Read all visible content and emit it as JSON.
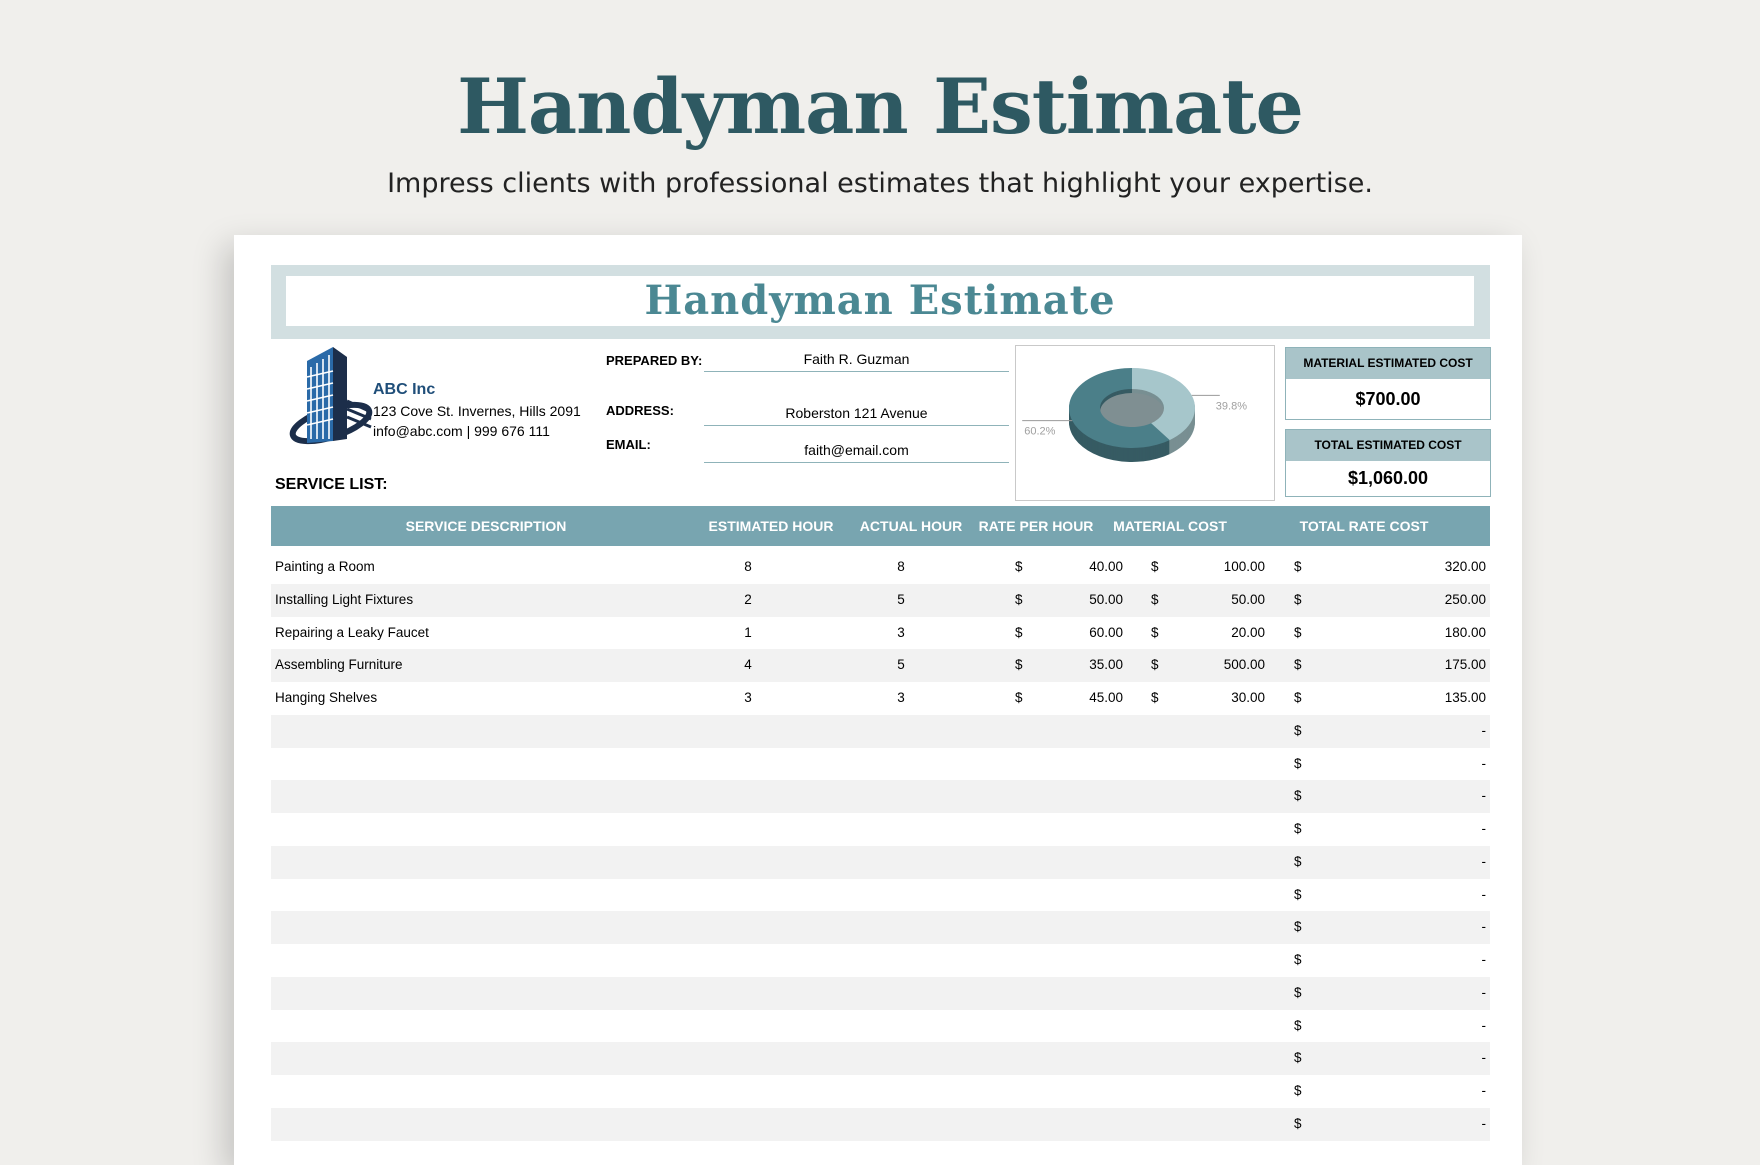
{
  "hero": {
    "title": "Handyman Estimate",
    "subtitle": "Impress clients with professional estimates that highlight your expertise."
  },
  "sheet": {
    "title": "Handyman Estimate",
    "company": {
      "name": "ABC Inc",
      "address": "123 Cove St. Invernes, Hills 2091",
      "contact": "info@abc.com | 999 676 111",
      "logo_icon": "building-logo-icon"
    },
    "prepared_by_label": "PREPARED BY:",
    "prepared_by": "Faith R. Guzman",
    "address_label": "ADDRESS:",
    "address": "Roberston 121 Avenue",
    "email_label": "EMAIL:",
    "email": "faith@email.com",
    "service_list_label": "SERVICE LIST:"
  },
  "summary": {
    "material_label": "MATERIAL ESTIMATED COST",
    "material_value": "$700.00",
    "total_label": "TOTAL ESTIMATED COST",
    "total_value": "$1,060.00"
  },
  "chart_data": {
    "type": "pie",
    "style": "3d-donut",
    "slices": [
      {
        "label": "39.8%",
        "value": 39.8,
        "color": "#a6c6cb"
      },
      {
        "label": "60.2%",
        "value": 60.2,
        "color": "#4b7f89"
      }
    ]
  },
  "table": {
    "columns": [
      "SERVICE DESCRIPTION",
      "ESTIMATED HOUR",
      "ACTUAL HOUR",
      "RATE PER HOUR",
      "MATERIAL COST",
      "TOTAL RATE COST"
    ],
    "currency": "$",
    "rows": [
      {
        "desc": "Painting a Room",
        "est": "8",
        "act": "8",
        "rate": "40.00",
        "mat": "100.00",
        "total": "320.00"
      },
      {
        "desc": "Installing Light Fixtures",
        "est": "2",
        "act": "5",
        "rate": "50.00",
        "mat": "50.00",
        "total": "250.00"
      },
      {
        "desc": "Repairing a Leaky Faucet",
        "est": "1",
        "act": "3",
        "rate": "60.00",
        "mat": "20.00",
        "total": "180.00"
      },
      {
        "desc": "Assembling Furniture",
        "est": "4",
        "act": "5",
        "rate": "35.00",
        "mat": "500.00",
        "total": "175.00"
      },
      {
        "desc": "Hanging Shelves",
        "est": "3",
        "act": "3",
        "rate": "45.00",
        "mat": "30.00",
        "total": "135.00"
      }
    ],
    "empty_total": "-",
    "empty_row_count": 13
  },
  "colors": {
    "accent": "#4b8893",
    "header": "#78a5b0",
    "hero_title": "#2e5962"
  }
}
